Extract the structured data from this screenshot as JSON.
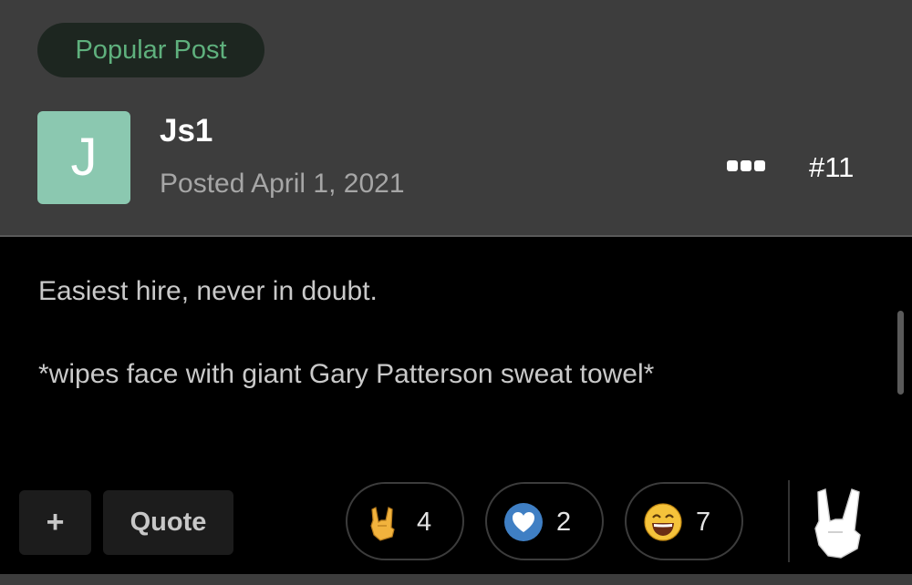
{
  "post": {
    "badge": "Popular Post",
    "avatar_letter": "J",
    "author": "Js1",
    "posted": "Posted April 1, 2021",
    "post_number": "#11",
    "lines": [
      "Easiest hire, never in doubt.",
      "*wipes face with giant Gary Patterson sweat towel*"
    ]
  },
  "actions": {
    "plus": "+",
    "quote": "Quote"
  },
  "reactions": [
    {
      "name": "rock-on",
      "icon": "rock-on-hand-icon",
      "count": "4"
    },
    {
      "name": "like",
      "icon": "heart-icon",
      "count": "2"
    },
    {
      "name": "haha",
      "icon": "laughing-face-icon",
      "count": "7"
    }
  ],
  "colors": {
    "badge_text": "#5fb07d",
    "avatar_bg": "#8bc8b0",
    "like_blue": "#3f7fc4"
  }
}
